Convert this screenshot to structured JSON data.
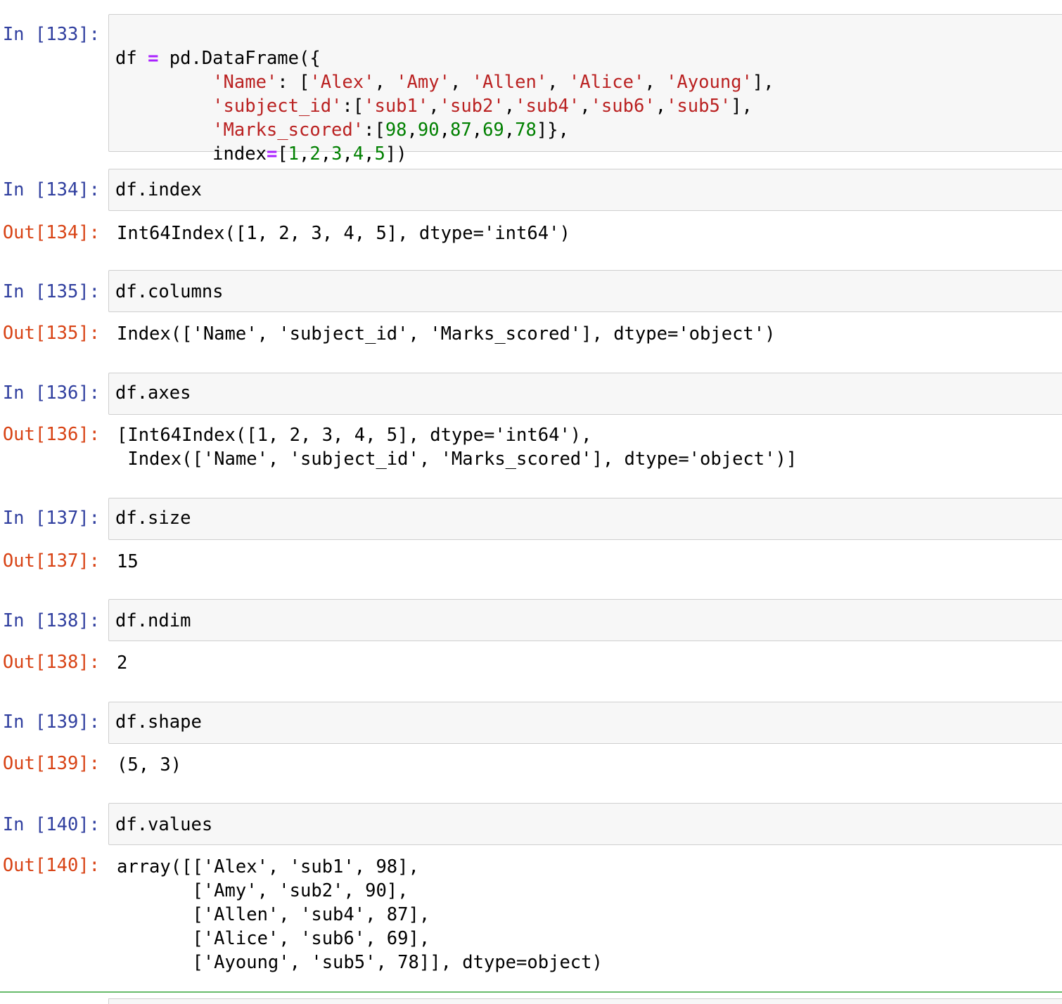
{
  "cells": [
    {
      "in_prompt": "In [133]:",
      "code": {
        "l1_a": "df ",
        "l1_op": "=",
        "l1_b": " pd.DataFrame({",
        "l2_k": "'Name'",
        "l2_c": ": [",
        "l2_v1": "'Alex'",
        "l2_s1": ", ",
        "l2_v2": "'Amy'",
        "l2_s2": ", ",
        "l2_v3": "'Allen'",
        "l2_s3": ", ",
        "l2_v4": "'Alice'",
        "l2_s4": ", ",
        "l2_v5": "'Ayoung'",
        "l2_end": "],",
        "l3_k": "'subject_id'",
        "l3_c": ":[",
        "l3_v1": "'sub1'",
        "l3_s1": ",",
        "l3_v2": "'sub2'",
        "l3_s2": ",",
        "l3_v3": "'sub4'",
        "l3_s3": ",",
        "l3_v4": "'sub6'",
        "l3_s4": ",",
        "l3_v5": "'sub5'",
        "l3_end": "],",
        "l4_k": "'Marks_scored'",
        "l4_c": ":[",
        "l4_v1": "98",
        "l4_s1": ",",
        "l4_v2": "90",
        "l4_s2": ",",
        "l4_v3": "87",
        "l4_s3": ",",
        "l4_v4": "69",
        "l4_s4": ",",
        "l4_v5": "78",
        "l4_end": "]},",
        "l5_a": "index",
        "l5_op": "=",
        "l5_c": "[",
        "l5_v1": "1",
        "l5_s1": ",",
        "l5_v2": "2",
        "l5_s2": ",",
        "l5_v3": "3",
        "l5_s3": ",",
        "l5_v4": "4",
        "l5_s4": ",",
        "l5_v5": "5",
        "l5_end": "])"
      }
    },
    {
      "in_prompt": "In [134]:",
      "code": "df.index",
      "out_prompt": "Out[134]:",
      "output": "Int64Index([1, 2, 3, 4, 5], dtype='int64')"
    },
    {
      "in_prompt": "In [135]:",
      "code": "df.columns",
      "out_prompt": "Out[135]:",
      "output": "Index(['Name', 'subject_id', 'Marks_scored'], dtype='object')"
    },
    {
      "in_prompt": "In [136]:",
      "code": "df.axes",
      "out_prompt": "Out[136]:",
      "output": "[Int64Index([1, 2, 3, 4, 5], dtype='int64'),\n Index(['Name', 'subject_id', 'Marks_scored'], dtype='object')]"
    },
    {
      "in_prompt": "In [137]:",
      "code": "df.size",
      "out_prompt": "Out[137]:",
      "output": "15"
    },
    {
      "in_prompt": "In [138]:",
      "code": "df.ndim",
      "out_prompt": "Out[138]:",
      "output": "2"
    },
    {
      "in_prompt": "In [139]:",
      "code": "df.shape",
      "out_prompt": "Out[139]:",
      "output": "(5, 3)"
    },
    {
      "in_prompt": "In [140]:",
      "code": "df.values",
      "out_prompt": "Out[140]:",
      "output": "array([['Alex', 'sub1', 98],\n       ['Amy', 'sub2', 90],\n       ['Allen', 'sub4', 87],\n       ['Alice', 'sub6', 69],\n       ['Ayoung', 'sub5', 78]], dtype=object)"
    }
  ],
  "colors": {
    "in_prompt": "#303f9f",
    "out_prompt": "#d84315",
    "string": "#ba2121",
    "number": "#008000",
    "operator": "#aa22ff",
    "input_bg": "#f7f7f7",
    "selected_cell_rule": "#66bb6a"
  }
}
